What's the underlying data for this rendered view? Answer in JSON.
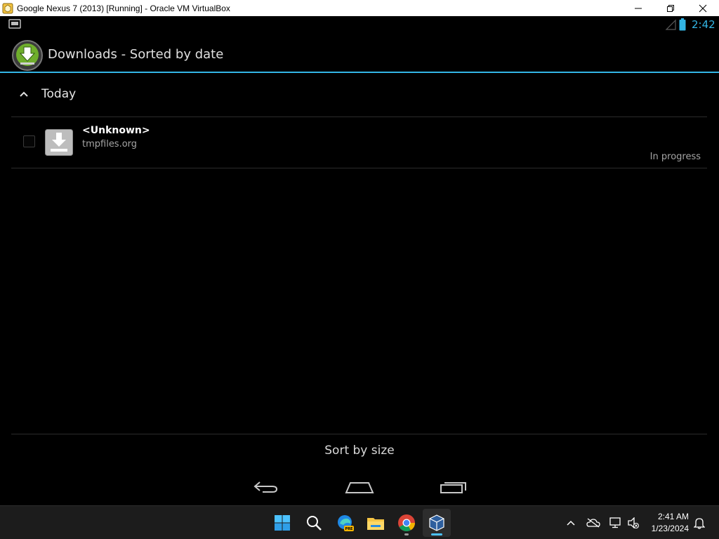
{
  "window": {
    "title": "Google Nexus 7 (2013) [Running] - Oracle VM VirtualBox",
    "icon": "virtualbox-icon",
    "controls": [
      "minimize-icon",
      "maximize-icon",
      "close-icon"
    ]
  },
  "statusbar": {
    "time": "2:42",
    "accent": "#33b5e5",
    "icons": [
      "notification-icon",
      "signal-icon",
      "battery-icon"
    ]
  },
  "actionbar": {
    "title": "Downloads - Sorted by date",
    "icon": "downloads-app-icon"
  },
  "list": {
    "sections": [
      {
        "header": "Today",
        "items": [
          {
            "name": "<Unknown>",
            "source": "tmpfiles.org",
            "status": "In progress",
            "icon": "download-file-icon"
          }
        ]
      }
    ]
  },
  "bottom_action": {
    "label": "Sort by size"
  },
  "navbar": {
    "buttons": [
      "back-icon",
      "home-icon",
      "recents-icon"
    ]
  },
  "taskbar": {
    "apps": [
      "windows-start-icon",
      "search-icon",
      "edge-canary-icon",
      "file-explorer-icon",
      "chrome-icon",
      "virtualbox-icon"
    ],
    "tray_icons": [
      "chevron-up-icon",
      "onedrive-icon",
      "network-icon",
      "volume-icon",
      "notification-bell-icon"
    ],
    "time": "2:41 AM",
    "date": "1/23/2024"
  }
}
